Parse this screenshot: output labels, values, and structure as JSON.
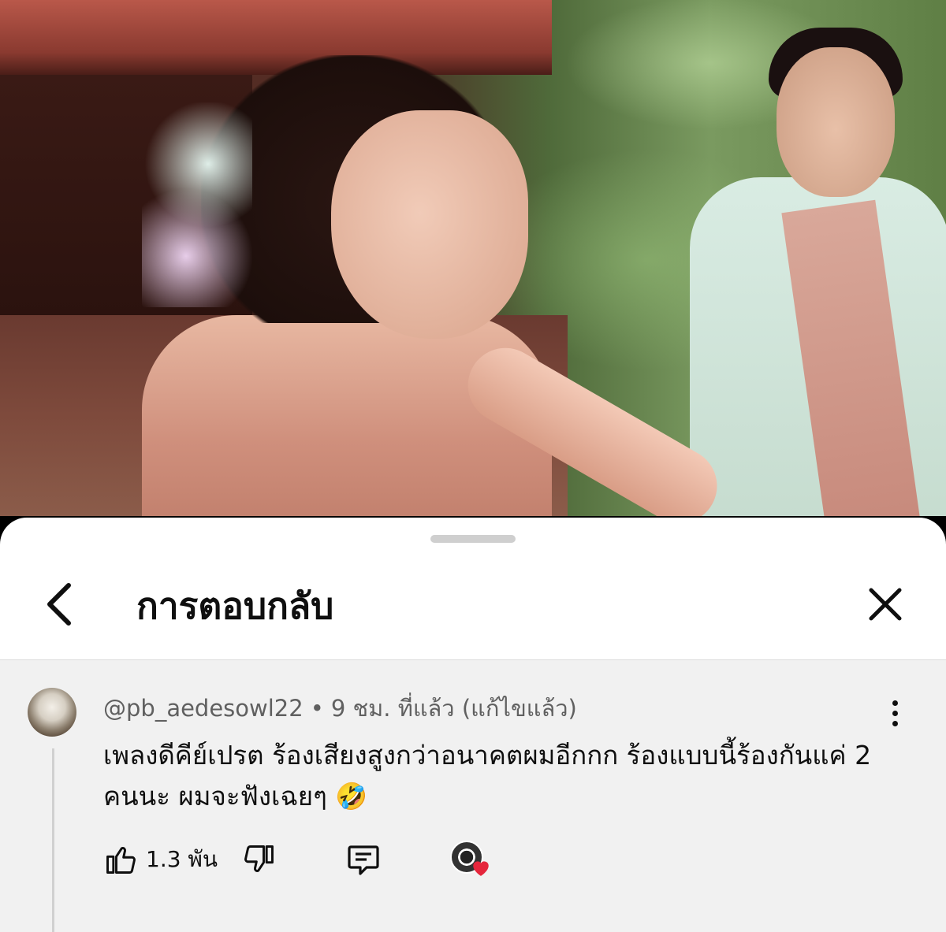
{
  "sheet": {
    "title": "การตอบกลับ"
  },
  "comment": {
    "author": "@pb_aedesowl22",
    "separator": "•",
    "time": "9 ชม. ที่แล้ว",
    "edited": "(แก้ไขแล้ว)",
    "text": "เพลงดีคีย์เปรต ร้องเสียงสูงกว่าอนาคตผมอีกกก ร้องแบบนี้ร้องกันแค่ 2 คนนะ ผมจะฟังเฉยๆ 🤣",
    "like_count": "1.3 พัน"
  },
  "icons": {
    "back": "chevron-left-icon",
    "close": "close-icon",
    "menu": "more-vertical-icon",
    "like": "thumb-up-icon",
    "dislike": "thumb-down-icon",
    "reply": "comment-icon",
    "creator_heart": "heart-icon"
  },
  "colors": {
    "heart": "#e5263c",
    "comment_background": "#f1f1f1",
    "secondary_text": "#606060"
  }
}
